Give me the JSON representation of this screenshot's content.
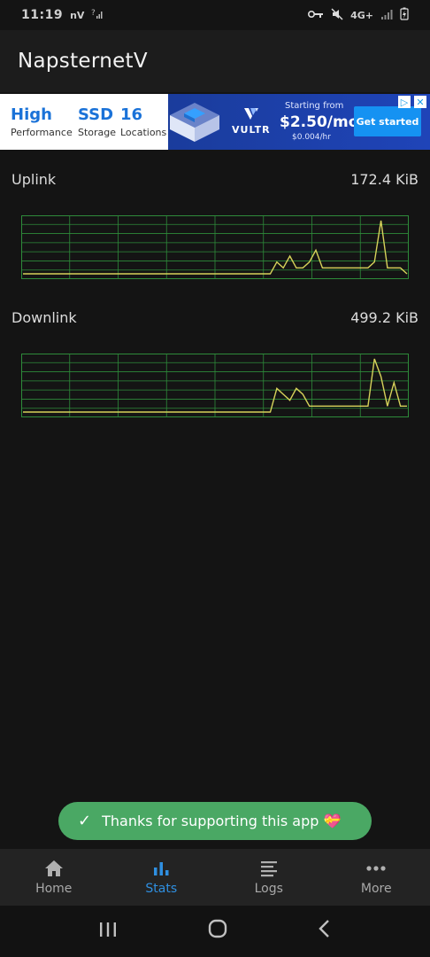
{
  "status_bar": {
    "time": "11:19",
    "carrier_icon": "nV",
    "network": "4G+"
  },
  "app": {
    "title": "NapsternetV"
  },
  "ad": {
    "headline_1": "High",
    "sub_1": "Performance",
    "headline_2": "SSD",
    "sub_2": "Storage",
    "headline_3": "16",
    "sub_3": "Locations",
    "brand": "VULTR",
    "from_label": "Starting from",
    "price": "$2.50/mo",
    "hourly": "$0.004/hr",
    "cta": "Get started",
    "colors": {
      "accent": "#1a72d8",
      "banner": "#1f44b8",
      "cta": "#1592f2"
    }
  },
  "stats": {
    "uplink": {
      "label": "Uplink",
      "value": "172.4 KiB",
      "chart_data": {
        "type": "line",
        "x": [
          0,
          1,
          2,
          3,
          4,
          5,
          6,
          7,
          8,
          9,
          10,
          11,
          12,
          13,
          14,
          15,
          16,
          17,
          18,
          19,
          20,
          21,
          22,
          23,
          24,
          25,
          26,
          27,
          28,
          29,
          30,
          31,
          32,
          33,
          34,
          35,
          36,
          37,
          38,
          39,
          40,
          41,
          42,
          43,
          44,
          45,
          46,
          47,
          48,
          49,
          50,
          51,
          52,
          53,
          54,
          55,
          56,
          57,
          58,
          59
        ],
        "values": [
          0,
          0,
          0,
          0,
          0,
          0,
          0,
          0,
          0,
          0,
          0,
          0,
          0,
          0,
          0,
          0,
          0,
          0,
          0,
          0,
          0,
          0,
          0,
          0,
          0,
          0,
          0,
          0,
          0,
          0,
          0,
          0,
          0,
          0,
          0,
          0,
          0,
          0,
          0,
          2,
          1,
          3,
          1,
          1,
          2,
          4,
          1,
          1,
          1,
          1,
          1,
          1,
          1,
          1,
          2,
          9,
          1,
          1,
          1,
          0
        ],
        "color": "#d6d25a",
        "grid": true,
        "grid_color": "#2e8b3a"
      }
    },
    "downlink": {
      "label": "Downlink",
      "value": "499.2 KiB",
      "chart_data": {
        "type": "line",
        "x": [
          0,
          1,
          2,
          3,
          4,
          5,
          6,
          7,
          8,
          9,
          10,
          11,
          12,
          13,
          14,
          15,
          16,
          17,
          18,
          19,
          20,
          21,
          22,
          23,
          24,
          25,
          26,
          27,
          28,
          29,
          30,
          31,
          32,
          33,
          34,
          35,
          36,
          37,
          38,
          39,
          40,
          41,
          42,
          43,
          44,
          45,
          46,
          47,
          48,
          49,
          50,
          51,
          52,
          53,
          54,
          55,
          56,
          57,
          58,
          59
        ],
        "values": [
          0,
          0,
          0,
          0,
          0,
          0,
          0,
          0,
          0,
          0,
          0,
          0,
          0,
          0,
          0,
          0,
          0,
          0,
          0,
          0,
          0,
          0,
          0,
          0,
          0,
          0,
          0,
          0,
          0,
          0,
          0,
          0,
          0,
          0,
          0,
          0,
          0,
          0,
          0,
          4,
          3,
          2,
          4,
          3,
          1,
          1,
          1,
          1,
          1,
          1,
          1,
          1,
          1,
          1,
          9,
          6,
          1,
          5,
          1,
          1
        ],
        "color": "#d6d25a",
        "grid": true,
        "grid_color": "#2e8b3a"
      }
    }
  },
  "toast": {
    "text": "Thanks for supporting this app 💝"
  },
  "nav": {
    "items": [
      {
        "label": "Home",
        "icon": "home-icon",
        "active": false
      },
      {
        "label": "Stats",
        "icon": "bar-chart-icon",
        "active": true
      },
      {
        "label": "Logs",
        "icon": "logs-icon",
        "active": false
      },
      {
        "label": "More",
        "icon": "more-dots-icon",
        "active": false
      }
    ]
  }
}
